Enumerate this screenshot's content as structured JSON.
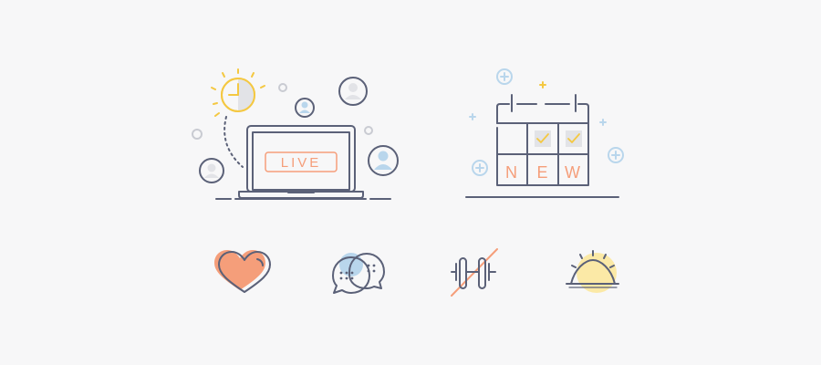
{
  "live_scene": {
    "badge_text": "LIVE"
  },
  "calendar_scene": {
    "cells": [
      "N",
      "E",
      "W"
    ]
  },
  "colors": {
    "background": "#f7f7f8",
    "line": "#5b6178",
    "accent_orange": "#f59e7a",
    "accent_yellow": "#f4c842",
    "sun_fill": "#fbe9a6",
    "light_blue": "#b9d6ec",
    "grey_fill": "#e2e3e7",
    "pale_outline": "#c9cbd2"
  },
  "icons": [
    "live-stream-icon",
    "calendar-new-icon",
    "heart-icon",
    "chat-bubbles-icon",
    "dumbbell-cancelled-icon",
    "sunrise-icon"
  ]
}
